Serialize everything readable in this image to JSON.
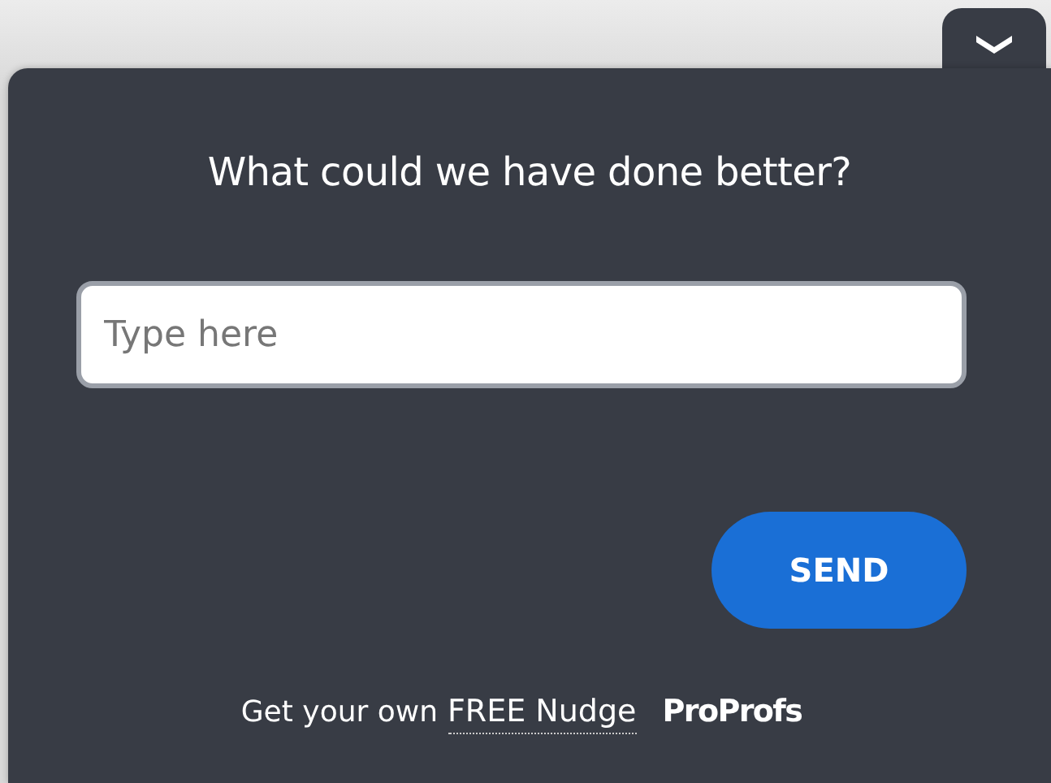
{
  "title": "What could we have done better?",
  "input": {
    "placeholder": "Type here"
  },
  "send_button": {
    "label": "SEND"
  },
  "footer": {
    "text": "Get your own",
    "link": "FREE Nudge",
    "brand": "ProProfs"
  }
}
